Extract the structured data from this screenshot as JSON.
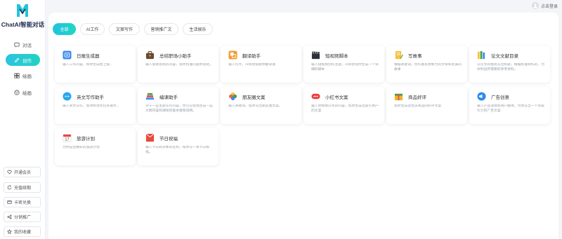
{
  "brand": {
    "name": "ChatAI智能对话"
  },
  "nav": [
    {
      "label": "对话",
      "icon": "chat-icon"
    },
    {
      "label": "创作",
      "icon": "edit-icon"
    },
    {
      "label": "绘画",
      "icon": "paint-icon"
    },
    {
      "label": "绘画",
      "icon": "palette-icon"
    }
  ],
  "side_buttons": [
    {
      "label": "开通会员",
      "icon": "heart-icon"
    },
    {
      "label": "充值续期",
      "icon": "refresh-icon"
    },
    {
      "label": "卡密兑换",
      "icon": "card-icon"
    },
    {
      "label": "分销推广",
      "icon": "share-icon"
    },
    {
      "label": "我的收藏",
      "icon": "star-icon"
    }
  ],
  "header": {
    "login_label": "点击登录"
  },
  "tabs": [
    "全部",
    "AI工作",
    "文案写作",
    "营销推广文",
    "生活娱乐"
  ],
  "cards": [
    {
      "title": "日报生成器",
      "desc": "输入工作内容，帮你生成给上级...",
      "icon": "calendar-icon",
      "color": "#3d8cf0"
    },
    {
      "title": "总结职场小助手",
      "desc": "输入需要总结的内容，帮你找准问题并总结。",
      "icon": "briefcase-icon",
      "color": "#6b4a2f"
    },
    {
      "title": "翻译助手",
      "desc": "输入作文，AI将会帮助你翻译语",
      "icon": "translate-icon",
      "color": "#f29b2f"
    },
    {
      "title": "短视频脚本",
      "desc": "输入短视频创作主题，AI将会帮你生成一个详细的脚本",
      "icon": "clapper-icon",
      "color": "#2e3138"
    },
    {
      "title": "写故事",
      "desc": "根据关键词，创作富有想象力的文章和优美的故事",
      "icon": "pen-icon",
      "color": "#f5c23b"
    },
    {
      "title": "论文文献目录",
      "desc": "以论文的格式写出标题，根据标准制作的，为你列出所需要的参考资料。",
      "icon": "books-icon",
      "color": "#43a048"
    },
    {
      "title": "英文写作助手",
      "desc": "输入英文写作，帮你修改优化英语文...",
      "icon": "chat-bubble-icon",
      "color": "#29a8ef"
    },
    {
      "title": "编课助手",
      "desc": "对于一些主题写作内容，你可以帮我生成一些大纲内容和课程的基本框架说明。",
      "icon": "book-stack-icon",
      "color": "#e05555"
    },
    {
      "title": "朋友圈文案",
      "desc": "输入关键词，帮你写出朋友圈文案。",
      "icon": "photos-icon",
      "color": "#e8543b"
    },
    {
      "title": "小红书文案",
      "desc": "输入你想要分享的内容，帮你生成出吸引用户的文案",
      "icon": "xhs-icon",
      "color": "#ee3b3b"
    },
    {
      "title": "商品好评",
      "desc": "帮你生成适合该商品的好评文案",
      "icon": "gift-icon",
      "color": "#f0b429"
    },
    {
      "title": "广告创意",
      "desc": "输入产品详情和用户群体，为你写出一个有吸引力的广告文案",
      "icon": "ad-icon",
      "color": "#2e8bf0"
    },
    {
      "title": "旅游计划",
      "desc": "为你提出精彩的旅游计划",
      "icon": "calendar-17-icon",
      "color": "#e64a3b"
    },
    {
      "title": "节日祝福",
      "desc": "输入节日和对象的名称，帮你写一条节日祝福。",
      "icon": "greeting-icon",
      "color": "#e64a3b"
    }
  ]
}
